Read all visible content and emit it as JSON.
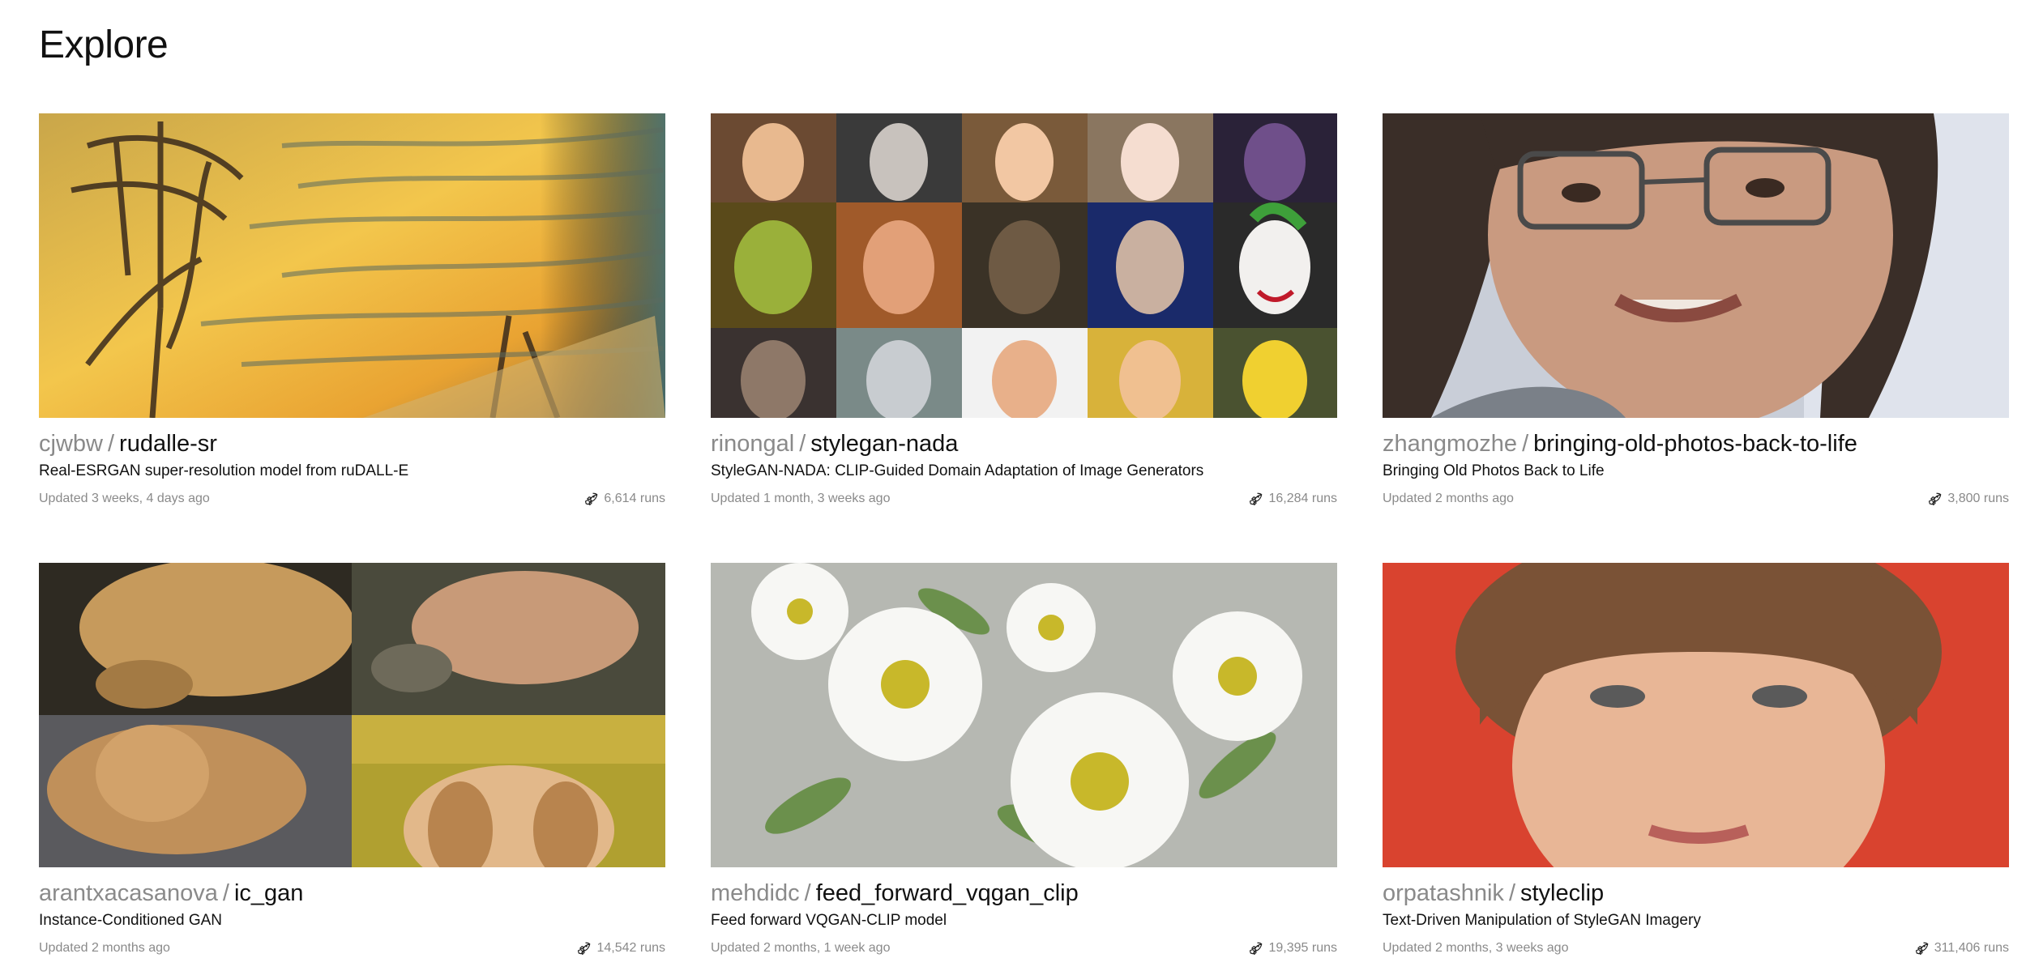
{
  "page": {
    "title": "Explore"
  },
  "icons": {
    "runs": "rocket-icon"
  },
  "cards": [
    {
      "owner": "cjwbw",
      "model": "rudalle-sr",
      "description": "Real-ESRGAN super-resolution model from ruDALL-E",
      "updated": "Updated 3 weeks, 4 days ago",
      "runs": "6,614 runs"
    },
    {
      "owner": "rinongal",
      "model": "stylegan-nada",
      "description": "StyleGAN-NADA: CLIP-Guided Domain Adaptation of Image Generators",
      "updated": "Updated 1 month, 3 weeks ago",
      "runs": "16,284 runs"
    },
    {
      "owner": "zhangmozhe",
      "model": "bringing-old-photos-back-to-life",
      "description": "Bringing Old Photos Back to Life",
      "updated": "Updated 2 months ago",
      "runs": "3,800 runs"
    },
    {
      "owner": "arantxacasanova",
      "model": "ic_gan",
      "description": "Instance-Conditioned GAN",
      "updated": "Updated 2 months ago",
      "runs": "14,542 runs"
    },
    {
      "owner": "mehdidc",
      "model": "feed_forward_vqgan_clip",
      "description": "Feed forward VQGAN-CLIP model",
      "updated": "Updated 2 months, 1 week ago",
      "runs": "19,395 runs"
    },
    {
      "owner": "orpatashnik",
      "model": "styleclip",
      "description": "Text-Driven Manipulation of StyleGAN Imagery",
      "updated": "Updated 2 months, 3 weeks ago",
      "runs": "311,406 runs"
    }
  ]
}
